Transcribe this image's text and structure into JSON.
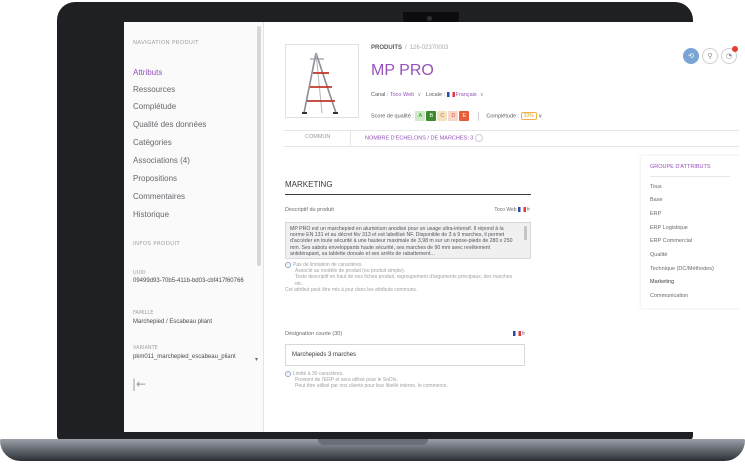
{
  "nav": {
    "heading": "NAVIGATION PRODUIT",
    "items": [
      {
        "label": "Attributs",
        "active": true
      },
      {
        "label": "Ressources"
      },
      {
        "label": "Complétude"
      },
      {
        "label": "Qualité des données"
      },
      {
        "label": "Catégories"
      },
      {
        "label": "Associations (4)"
      },
      {
        "label": "Propositions"
      },
      {
        "label": "Commentaires"
      },
      {
        "label": "Historique"
      }
    ]
  },
  "info": {
    "heading": "INFOS PRODUIT",
    "uuid_label": "UUID",
    "uuid_value": "09499d93-70b5-411b-bd03-cbf417f60766",
    "family_label": "FAMILLE",
    "family_value": "Marchepied / Escabeau pliant",
    "variant_label": "VARIANTE",
    "variant_value": "pkm011_marchepied_escabeau_pliant"
  },
  "header": {
    "breadcrumb_link": "PRODUITS",
    "breadcrumb_sep": "/",
    "breadcrumb_id": "126-02370003",
    "title": "MP PRO",
    "canal_label": "Canal :",
    "canal_value": "Toco Web",
    "locale_label": "Locale :",
    "locale_value": "Français",
    "quality_label": "Score de qualité :",
    "grades": [
      "A",
      "B",
      "C",
      "D",
      "E"
    ],
    "completude_label": "Complétude :",
    "completude_value": "33%"
  },
  "tabs": {
    "first": "COMMUN",
    "second": "NOMBRE D'ÉCHELONS / DE MARCHES: 3"
  },
  "groups": {
    "title": "GROUPE D'ATTRIBUTS",
    "items": [
      "Tous",
      "Base",
      "ERP",
      "ERP Logistique",
      "ERP Commercial",
      "Qualité",
      "Technique (DC/Méthodes)",
      "Marketing",
      "Communication"
    ]
  },
  "section": {
    "title": "MARKETING",
    "description_label": "Descriptif du produit",
    "description_scope": "Toco Web",
    "description_locale": "fr",
    "description_value": "MP PRO est un marchepied en aluminium anodisé pour un usage ultra-intensif. Il répond à la norme EN 131 et au décret fév 313 et est labellisé NF. Disponible de 3 à 9 marches, il permet d'accéder en toute sécurité à une hauteur maximale de 3,98 m sur un repose-pieds de 280 x 250 mm. Ses sabots enveloppants haute sécurité, ses marches de 90 mm avec revêtement antidérapant, sa tablette dorsale et ses arrêts de rabattement...",
    "description_hint_1": "Pas de limitation de caractères.",
    "description_hint_2": "Associé au modèle de produit (ou produit simple).",
    "description_hint_3": "Texte descriptif en haut de nos fiches produit, regroupement d'arguments principaux, des marches etc.",
    "description_hint_4": "Cet attribut peut être mis à jour dans les attributs communs.",
    "short_label": "Désignation courte (30)",
    "short_locale": "fr",
    "short_value": "Marchepieds 3 marches",
    "short_hint_1": "Limité à 30 caractères.",
    "short_hint_2": "Provient de l'ERP et sera utilisé pour le SoDIs.",
    "short_hint_3": "Peut être utilisé par nos clients pour leur libellé interne, le commerce."
  }
}
